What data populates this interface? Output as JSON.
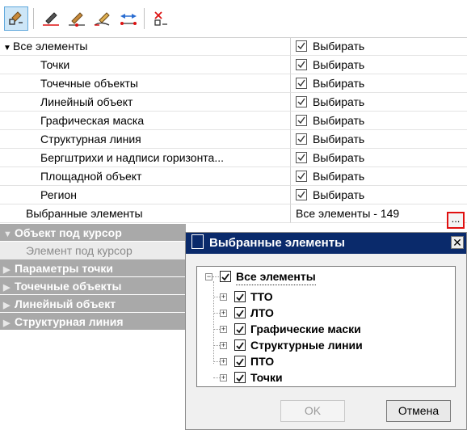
{
  "toolbar": {
    "buttons": [
      {
        "icon": "select-icon",
        "active": true
      },
      {
        "icon": "edit-line-icon"
      },
      {
        "icon": "edit-point-icon"
      },
      {
        "icon": "edit-curve-icon"
      },
      {
        "icon": "move-points-icon"
      },
      {
        "icon": "clear-selection-icon"
      }
    ]
  },
  "grid": {
    "rows": [
      {
        "label": "Все элементы",
        "value": "Выбирать",
        "checked": true,
        "root": true
      },
      {
        "label": "Точки",
        "value": "Выбирать",
        "checked": true
      },
      {
        "label": "Точечные объекты",
        "value": "Выбирать",
        "checked": true
      },
      {
        "label": "Линейный объект",
        "value": "Выбирать",
        "checked": true
      },
      {
        "label": "Графическая маска",
        "value": "Выбирать",
        "checked": true
      },
      {
        "label": "Структурная линия",
        "value": "Выбирать",
        "checked": true
      },
      {
        "label": "Бергштрихи и надписи горизонта...",
        "value": "Выбирать",
        "checked": true
      },
      {
        "label": "Площадной объект",
        "value": "Выбирать",
        "checked": true
      },
      {
        "label": "Регион",
        "value": "Выбирать",
        "checked": true
      }
    ],
    "selected_row": {
      "label": "Выбранные элементы",
      "value": "Все элементы - 149",
      "button": "..."
    },
    "categories": [
      {
        "label": "Объект под курсор",
        "expanded": true,
        "sub": "Элемент под курсор"
      },
      {
        "label": "Параметры точки",
        "expanded": false
      },
      {
        "label": "Точечные объекты",
        "expanded": false
      },
      {
        "label": "Линейный объект",
        "expanded": false
      },
      {
        "label": "Структурная линия",
        "expanded": false
      }
    ]
  },
  "dialog": {
    "title": "Выбранные элементы",
    "close": "✕",
    "tree_root": "Все элементы",
    "tree_items": [
      "ТТО",
      "ЛТО",
      "Графические маски",
      "Структурные линии",
      "ПТО",
      "Точки"
    ],
    "ok_label": "OK",
    "cancel_label": "Отмена"
  },
  "colors": {
    "category_bg": "#a9a9a9",
    "dialog_title_bg": "#0a2a6b",
    "highlight_border": "#e01010"
  }
}
